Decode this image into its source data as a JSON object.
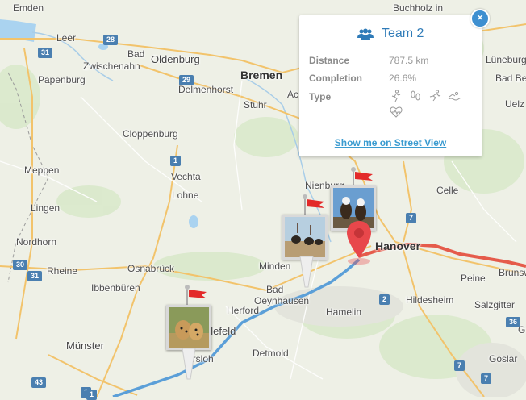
{
  "map": {
    "places": [
      {
        "name": "Emden",
        "cls": ""
      },
      {
        "name": "Leer",
        "cls": ""
      },
      {
        "name": "Bad",
        "cls": ""
      },
      {
        "name": "Zwischenahn",
        "cls": ""
      },
      {
        "name": "Oldenburg",
        "cls": "med"
      },
      {
        "name": "Papenburg",
        "cls": ""
      },
      {
        "name": "Delmenhorst",
        "cls": ""
      },
      {
        "name": "Bremen",
        "cls": "big"
      },
      {
        "name": "Stuhr",
        "cls": ""
      },
      {
        "name": "Ac",
        "cls": ""
      },
      {
        "name": "Buchholz in",
        "cls": ""
      },
      {
        "name": "Lüneburg",
        "cls": ""
      },
      {
        "name": "Bad Bev",
        "cls": ""
      },
      {
        "name": "Uelz",
        "cls": ""
      },
      {
        "name": "Cloppenburg",
        "cls": ""
      },
      {
        "name": "Meppen",
        "cls": ""
      },
      {
        "name": "Vechta",
        "cls": ""
      },
      {
        "name": "Lohne",
        "cls": ""
      },
      {
        "name": "Lingen",
        "cls": ""
      },
      {
        "name": "Nienburg",
        "cls": ""
      },
      {
        "name": "Celle",
        "cls": ""
      },
      {
        "name": "Nordhorn",
        "cls": ""
      },
      {
        "name": "Rheine",
        "cls": ""
      },
      {
        "name": "Osnabrück",
        "cls": ""
      },
      {
        "name": "Ibbenbüren",
        "cls": ""
      },
      {
        "name": "Minden",
        "cls": ""
      },
      {
        "name": "Hanover",
        "cls": "big"
      },
      {
        "name": "Peine",
        "cls": ""
      },
      {
        "name": "Brunsw",
        "cls": ""
      },
      {
        "name": "Bad",
        "cls": ""
      },
      {
        "name": "Oeynhausen",
        "cls": ""
      },
      {
        "name": "Herford",
        "cls": ""
      },
      {
        "name": "Hamelin",
        "cls": ""
      },
      {
        "name": "Hildesheim",
        "cls": ""
      },
      {
        "name": "Salzgitter",
        "cls": ""
      },
      {
        "name": "elefeld",
        "cls": "med"
      },
      {
        "name": "Münster",
        "cls": "med"
      },
      {
        "name": "Detmold",
        "cls": ""
      },
      {
        "name": "G",
        "cls": ""
      },
      {
        "name": "ersloh",
        "cls": ""
      },
      {
        "name": "Goslar",
        "cls": ""
      }
    ],
    "shields": [
      "28",
      "31",
      "29",
      "1",
      "1",
      "7",
      "30",
      "31",
      "2",
      "7",
      "36",
      "43",
      "1",
      "7"
    ]
  },
  "popup": {
    "team_name": "Team 2",
    "distance_label": "Distance",
    "distance_value": "787.5 km",
    "completion_label": "Completion",
    "completion_value": "26.6%",
    "type_label": "Type",
    "type_icons": [
      "running-icon",
      "footprints-icon",
      "running-icon",
      "swimming-icon",
      "heartbeat-icon"
    ],
    "street_view_link": "Show me on Street View",
    "close_label": "×"
  },
  "markers": [
    {
      "name": "eagles-marker",
      "photo": "eagles"
    },
    {
      "name": "ostrich-marker",
      "photo": "ostriches"
    },
    {
      "name": "cheetah-marker",
      "photo": "cheetahs"
    }
  ],
  "colors": {
    "route_blue": "#5b9fd8",
    "route_red": "#e55b4b",
    "pin_red": "#e8474b",
    "flag_red": "#e32a2a",
    "accent": "#2f7bb8"
  }
}
